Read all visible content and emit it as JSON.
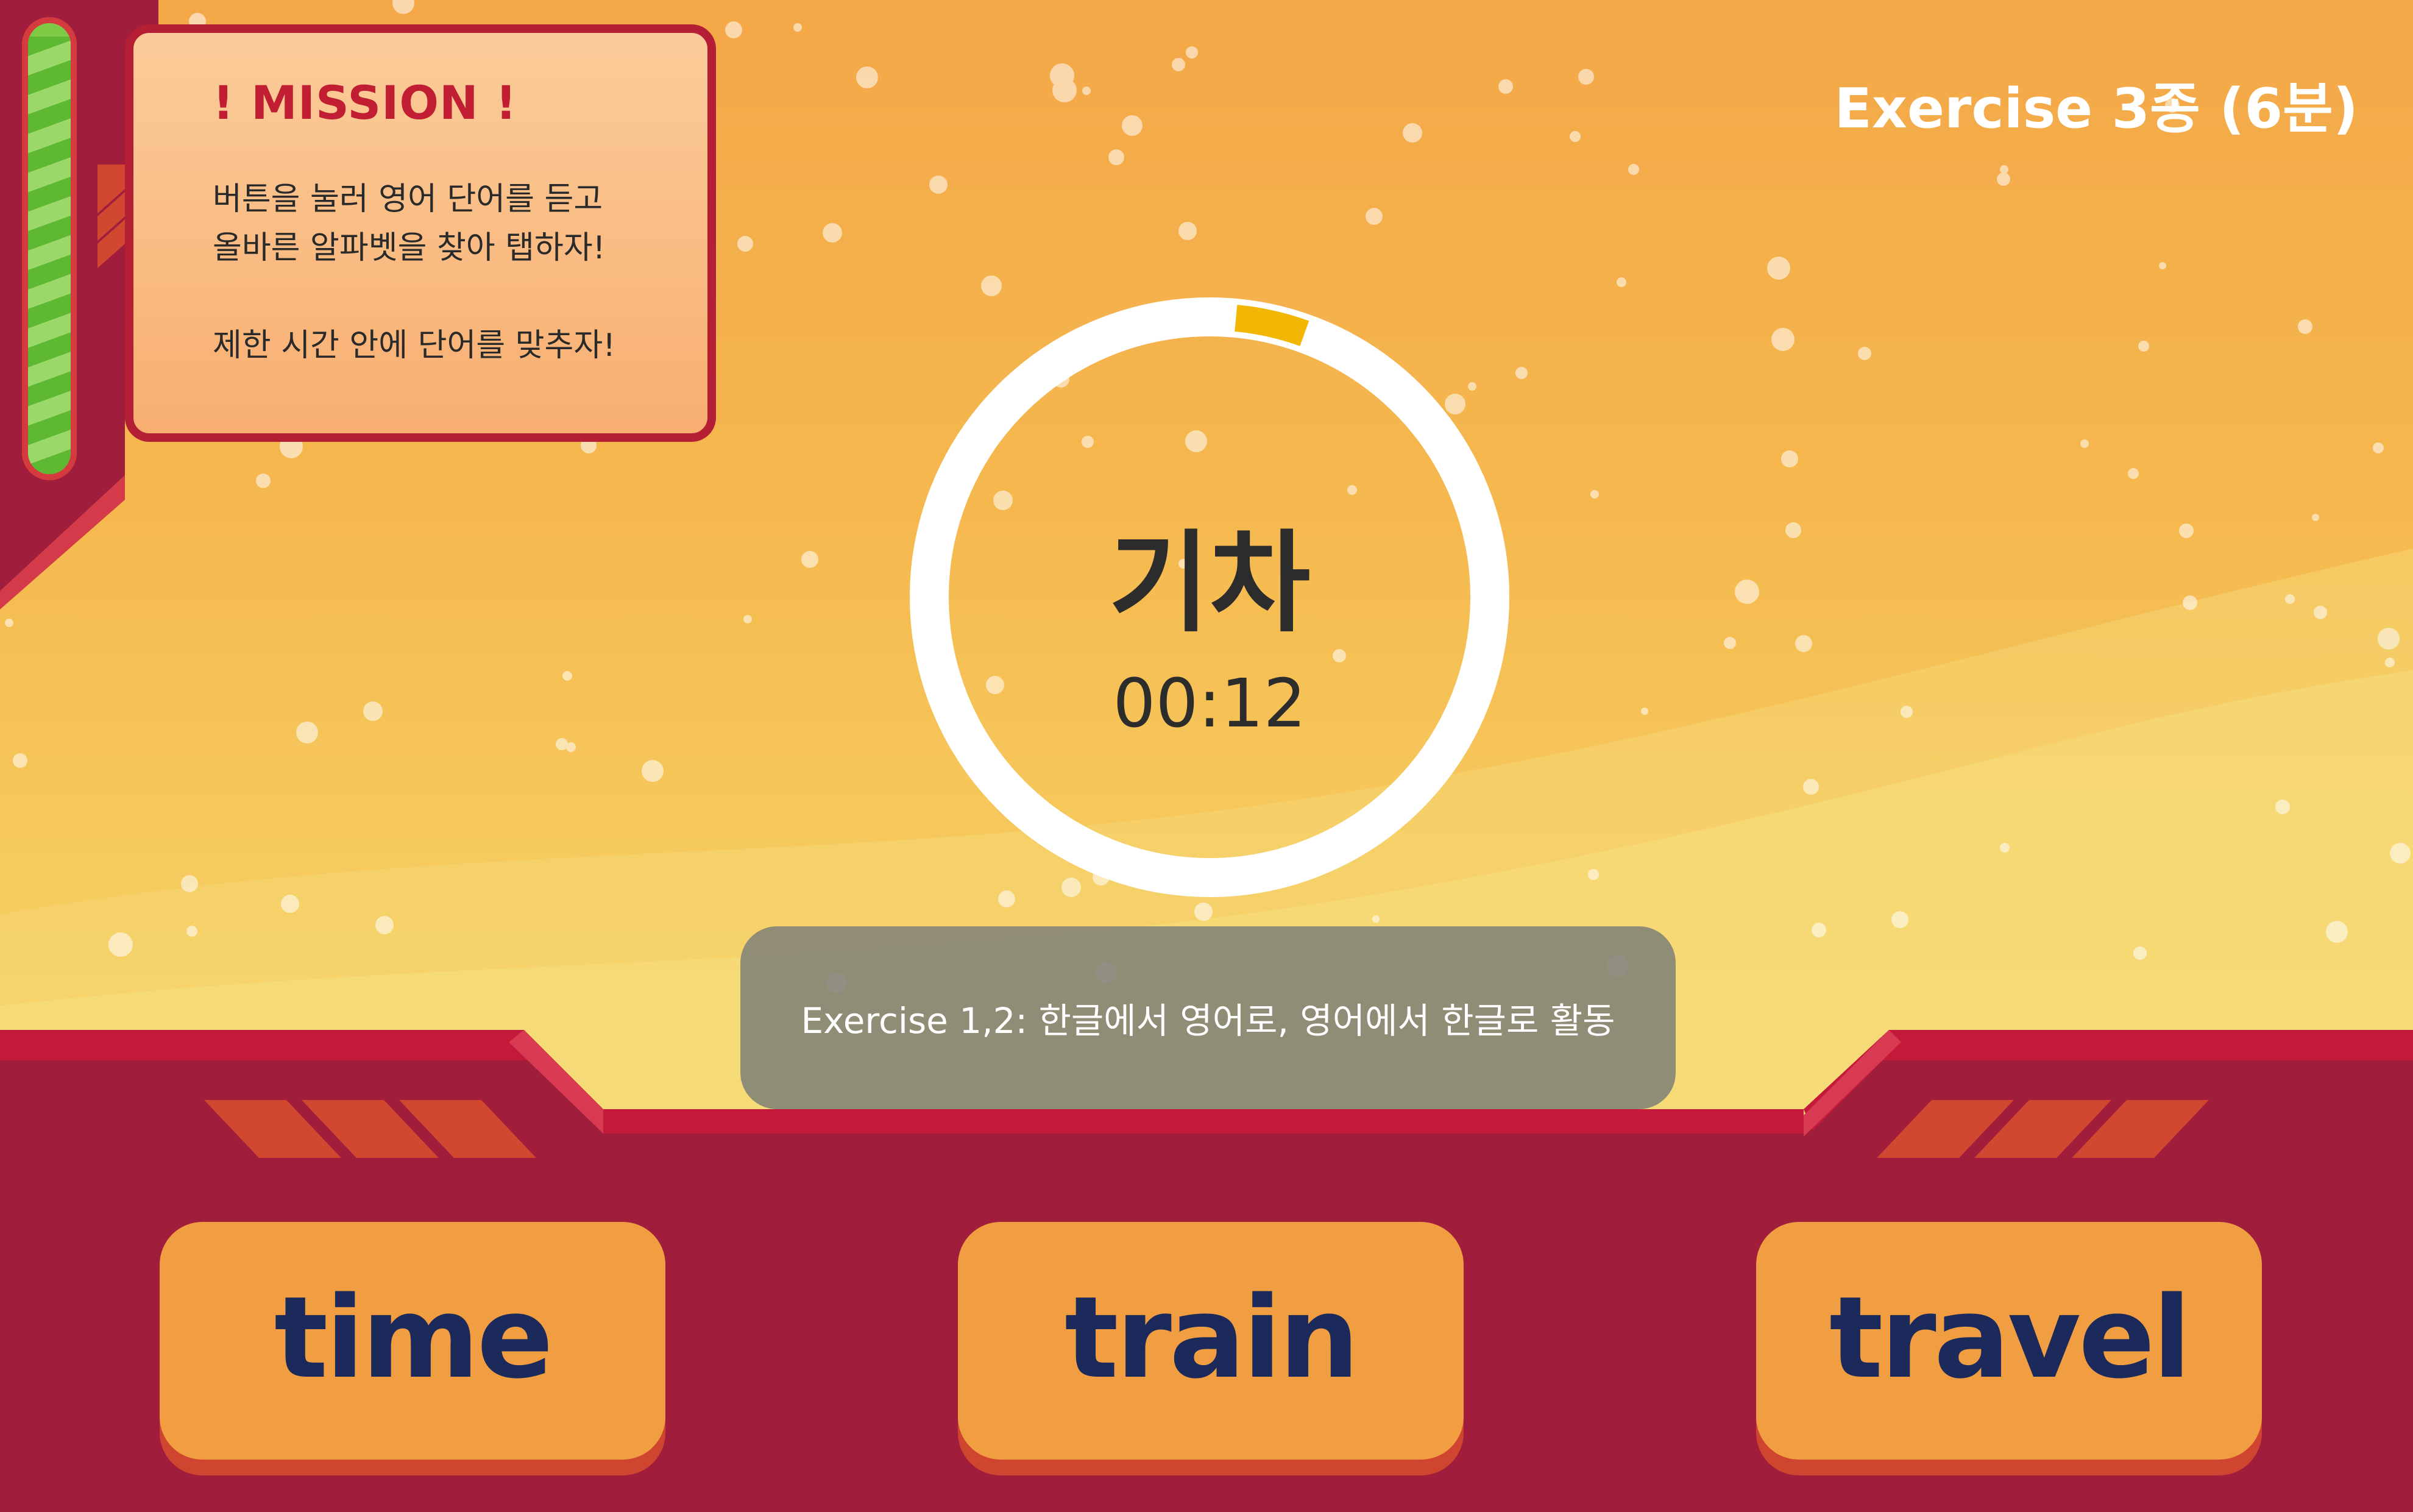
{
  "header": {
    "exercise_title": "Exercise 3종 (6분)"
  },
  "mission": {
    "title": "! MISSION !",
    "lines": [
      "버튼을 눌러 영어 단어를 듣고",
      "올바른 알파벳을 찾아 탭하자!",
      "제한 시간 안에 단어를 맞추자!"
    ]
  },
  "progress": {
    "level": 0.97
  },
  "quiz": {
    "prompt_word": "기차",
    "timer": "00:12",
    "timer_remaining_fraction": 0.96
  },
  "tooltip": {
    "text": "Exercise 1,2: 한글에서 영어로, 영어에서 한글로 활동"
  },
  "answers": [
    {
      "label": "time"
    },
    {
      "label": "train"
    },
    {
      "label": "travel"
    }
  ],
  "colors": {
    "accent_red": "#b41f36",
    "console_dark": "#a01d3c",
    "button_orange": "#f19d42",
    "button_text": "#1b2a5a",
    "timer_accent": "#f2b705",
    "progress_green": "#7fca45"
  }
}
